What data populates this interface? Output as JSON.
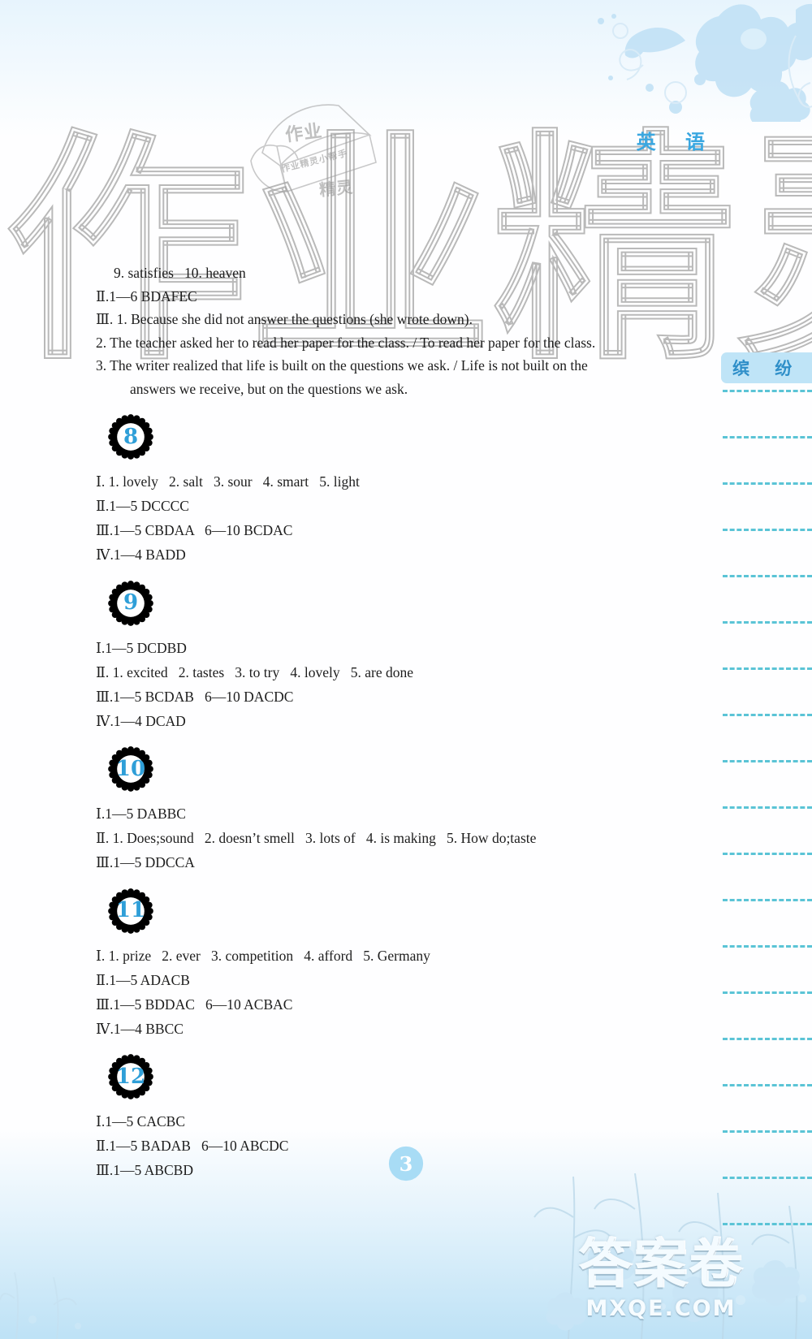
{
  "header": {
    "subject": "英 语",
    "side_tab_label": "缤 纷"
  },
  "watermark": {
    "big_chars": [
      "作",
      "业",
      "精",
      "灵"
    ],
    "book_line1": "作业",
    "book_line2": "作业精灵小帮手",
    "book_line3": "精灵",
    "brand_cn": "答案卷",
    "brand_en": "MXQE.COM"
  },
  "page_number": "3",
  "continued_section": {
    "lines": [
      {
        "text": "9. satisfies   10. heaven",
        "indent": "pad"
      },
      {
        "text": "Ⅱ.1—6 BDAFEC",
        "indent": "none"
      },
      {
        "text": "Ⅲ. 1. Because she did not answer the questions (she wrote down).",
        "indent": "none"
      },
      {
        "text": "2. The teacher asked her to read her paper for the class. / To read her paper for the class.",
        "indent": "none"
      },
      {
        "text": "3. The writer realized that life is built on the questions we ask. / Life is not built on the",
        "indent": "none"
      },
      {
        "text": "answers we receive, but on the questions we ask.",
        "indent": "indent"
      }
    ]
  },
  "units": [
    {
      "number": "8",
      "lines": [
        "Ⅰ. 1. lovely   2. salt   3. sour   4. smart   5. light",
        "Ⅱ.1—5 DCCCC",
        "Ⅲ.1—5 CBDAA   6—10 BCDAC",
        "Ⅳ.1—4 BADD"
      ]
    },
    {
      "number": "9",
      "lines": [
        "Ⅰ.1—5 DCDBD",
        "Ⅱ. 1. excited   2. tastes   3. to try   4. lovely   5. are done",
        "Ⅲ.1—5 BCDAB   6—10 DACDC",
        "Ⅳ.1—4 DCAD"
      ]
    },
    {
      "number": "10",
      "lines": [
        "Ⅰ.1—5 DABBC",
        "Ⅱ. 1. Does;sound   2. doesn’t smell   3. lots of   4. is making   5. How do;taste",
        "Ⅲ.1—5 DDCCA"
      ]
    },
    {
      "number": "11",
      "lines": [
        "Ⅰ. 1. prize   2. ever   3. competition   4. afford   5. Germany",
        "Ⅱ.1—5 ADACB",
        "Ⅲ.1—5 BDDAC   6—10 ACBAC",
        "Ⅳ.1—4 BBCC"
      ]
    },
    {
      "number": "12",
      "lines": [
        "Ⅰ.1—5 CACBC",
        "Ⅱ.1—5 BADAB   6—10 ABCDC",
        "Ⅲ.1—5 ABCBD"
      ]
    }
  ],
  "margin_rules_count": 19,
  "colors": {
    "accent_blue": "#4cb7e8",
    "tab_blue": "#bfe4f7",
    "rule_blue": "#5bc4d6",
    "text": "#1d1d1d"
  }
}
